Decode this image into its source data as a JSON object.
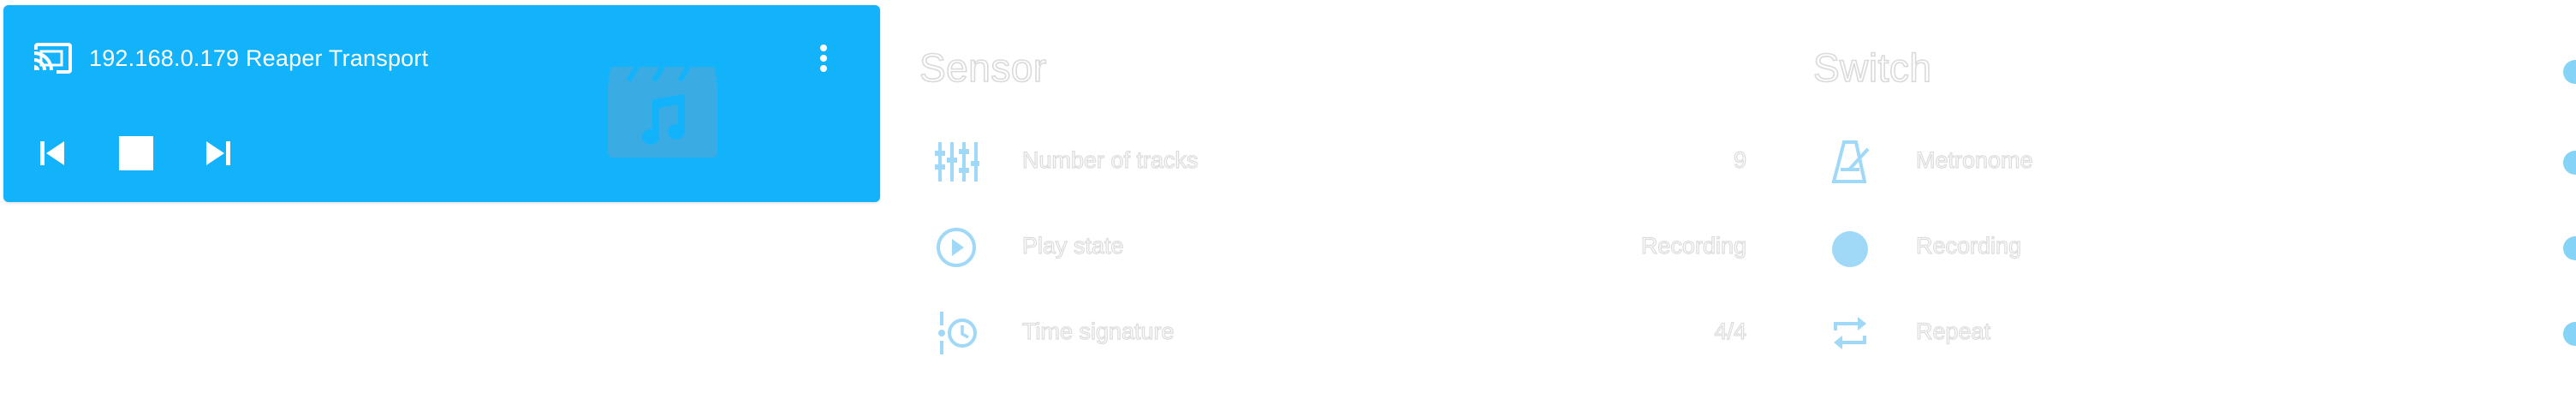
{
  "media_player": {
    "title": "192.168.0.179 Reaper Transport",
    "colors": {
      "card": "#12b3fb",
      "foreground": "#ffffff"
    },
    "icons": [
      "cast-icon",
      "more-vert-icon",
      "skip-previous-icon",
      "stop-icon",
      "skip-next-icon",
      "movie-music-icon"
    ]
  },
  "sensor": {
    "title": "Sensor",
    "rows": [
      {
        "label": "Number of tracks",
        "value": "9",
        "icon": "equalizer-icon"
      },
      {
        "label": "Play state",
        "value": "Recording",
        "icon": "play-circle-icon"
      },
      {
        "label": "Time signature",
        "value": "4/4",
        "icon": "timeline-clock-icon"
      }
    ]
  },
  "switch": {
    "title": "Switch",
    "rows": [
      {
        "label": "Metronome",
        "icon": "metronome-icon",
        "state": true
      },
      {
        "label": "Recording",
        "icon": "record-icon",
        "state": true
      },
      {
        "label": "Repeat",
        "icon": "repeat-icon",
        "state": true
      }
    ],
    "master_state": true
  },
  "colors": {
    "accent": "#0fa5f0",
    "icon_faded": "#9fd9f7",
    "text_faded": "#dcdcdc"
  }
}
